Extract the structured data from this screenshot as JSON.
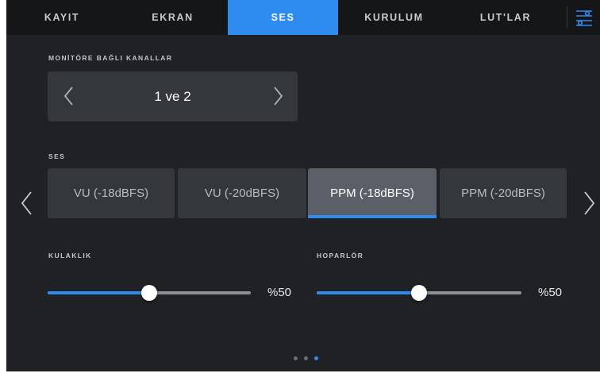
{
  "tabs": [
    {
      "label": "KAYIT",
      "active": false
    },
    {
      "label": "EKRAN",
      "active": false
    },
    {
      "label": "SES",
      "active": true
    },
    {
      "label": "KURULUM",
      "active": false
    },
    {
      "label": "LUT'LAR",
      "active": false
    }
  ],
  "menu_icon": "sliders-menu-icon",
  "monitor": {
    "label": "MONİTÖRE BAĞLI KANALLAR",
    "value": "1 ve 2"
  },
  "audio": {
    "label": "SES",
    "options": [
      {
        "label": "VU (-18dBFS)",
        "selected": false
      },
      {
        "label": "VU (-20dBFS)",
        "selected": false
      },
      {
        "label": "PPM (-18dBFS)",
        "selected": true
      },
      {
        "label": "PPM (-20dBFS)",
        "selected": false
      }
    ]
  },
  "headphones": {
    "label": "KULAKLIK",
    "level": 0.5,
    "value_text": "%50"
  },
  "speaker": {
    "label": "HOPARLÖR",
    "level": 0.5,
    "value_text": "%50"
  },
  "pages": {
    "count": 3,
    "current": 3
  },
  "colors": {
    "accent": "#2e8cf0",
    "background": "#202124",
    "tabbar": "#151618"
  }
}
